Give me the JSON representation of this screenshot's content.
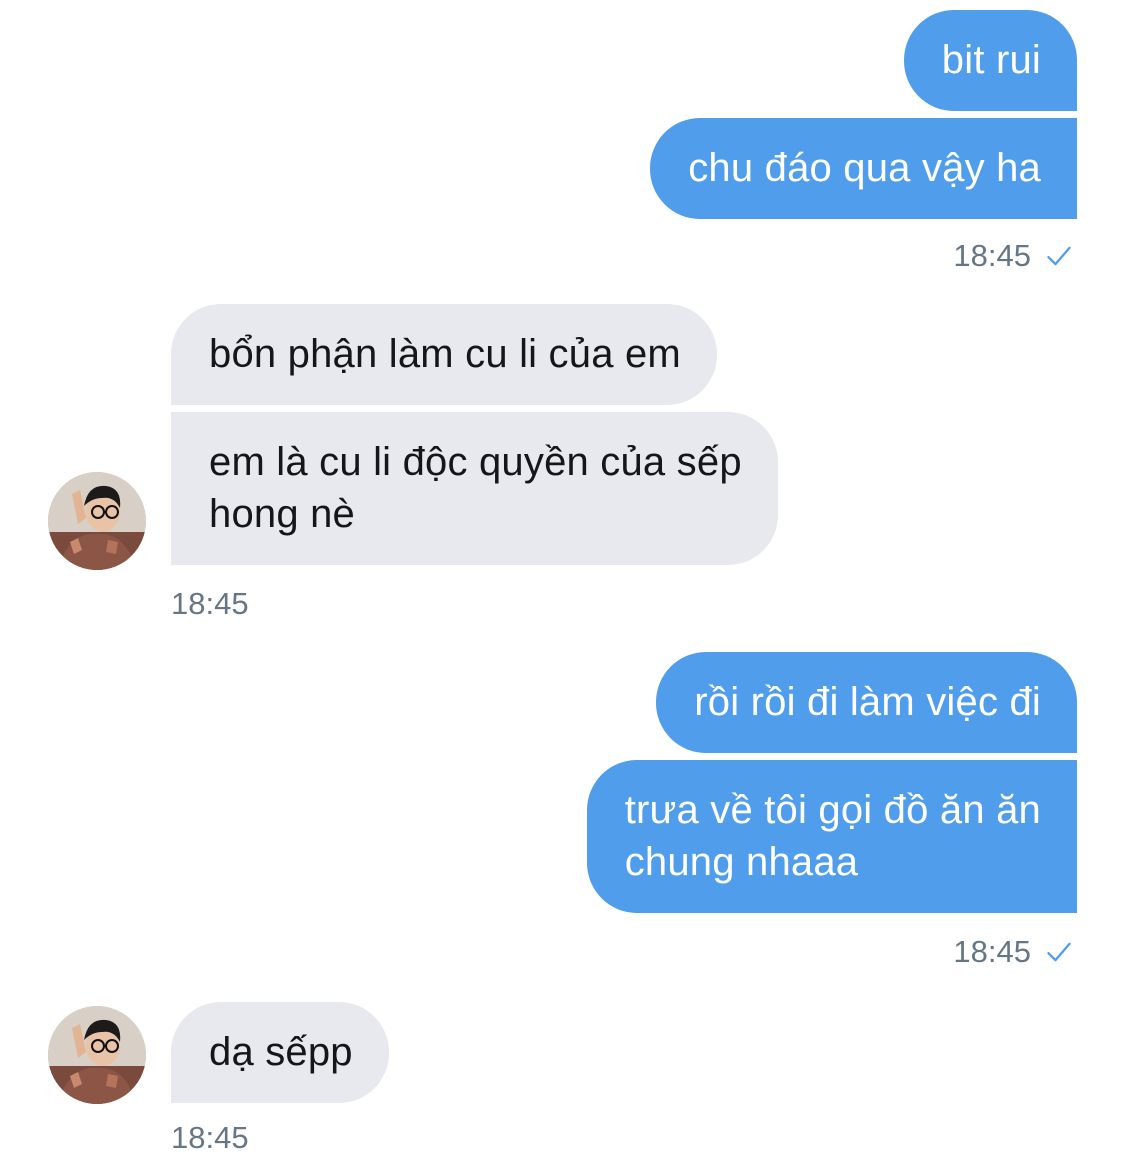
{
  "colors": {
    "outgoing_bubble": "#4f9deb",
    "incoming_bubble": "#e7e9ee",
    "timestamp": "#657786",
    "read_check": "#4f9deb"
  },
  "messages": [
    {
      "side": "outgoing",
      "text": "bit rui"
    },
    {
      "side": "outgoing",
      "text": "chu đáo qua vậy ha"
    },
    {
      "side": "outgoing_time",
      "text": "18:45",
      "icon": "checkmark-icon"
    },
    {
      "side": "incoming",
      "text": "bổn phận làm cu li của em"
    },
    {
      "side": "incoming",
      "text": "em là cu li độc quyền của sếp\nhong nè"
    },
    {
      "side": "incoming_time",
      "text": "18:45"
    },
    {
      "side": "outgoing",
      "text": "rồi rồi đi làm việc đi"
    },
    {
      "side": "outgoing",
      "text": "trưa về tôi gọi đồ ăn ăn\nchung nhaaa"
    },
    {
      "side": "outgoing_time",
      "text": "18:45",
      "icon": "checkmark-icon"
    },
    {
      "side": "incoming",
      "text": "dạ sếpp"
    },
    {
      "side": "incoming_time",
      "text": "18:45"
    }
  ]
}
